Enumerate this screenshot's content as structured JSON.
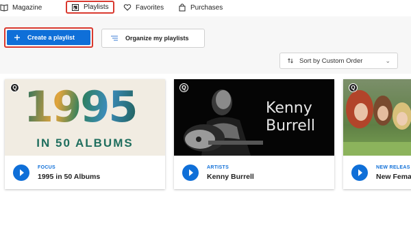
{
  "nav": {
    "items": [
      {
        "label": "Magazine",
        "icon": "magazine-icon"
      },
      {
        "label": "Playlists",
        "icon": "playlist-icon"
      },
      {
        "label": "Favorites",
        "icon": "heart-icon"
      },
      {
        "label": "Purchases",
        "icon": "shopping-bag-icon"
      }
    ],
    "active": "Playlists"
  },
  "actions": {
    "create_label": "Create a playlist",
    "organize_label": "Organize my playlists",
    "sort_label": "Sort by Custom Order"
  },
  "cards": [
    {
      "category": "FOCUS",
      "title": "1995 in 50 Albums",
      "cover_big": "1995",
      "cover_sub": "IN 50 ALBUMS"
    },
    {
      "category": "ARTISTS",
      "title": "Kenny Burrell",
      "cover_line1": "Kenny",
      "cover_line2": "Burrell"
    },
    {
      "category": "NEW RELEAS",
      "title": "New Fema"
    }
  ],
  "badge_letter": "Q",
  "colors": {
    "accent": "#0f6fd8",
    "highlight": "#d9382e"
  }
}
